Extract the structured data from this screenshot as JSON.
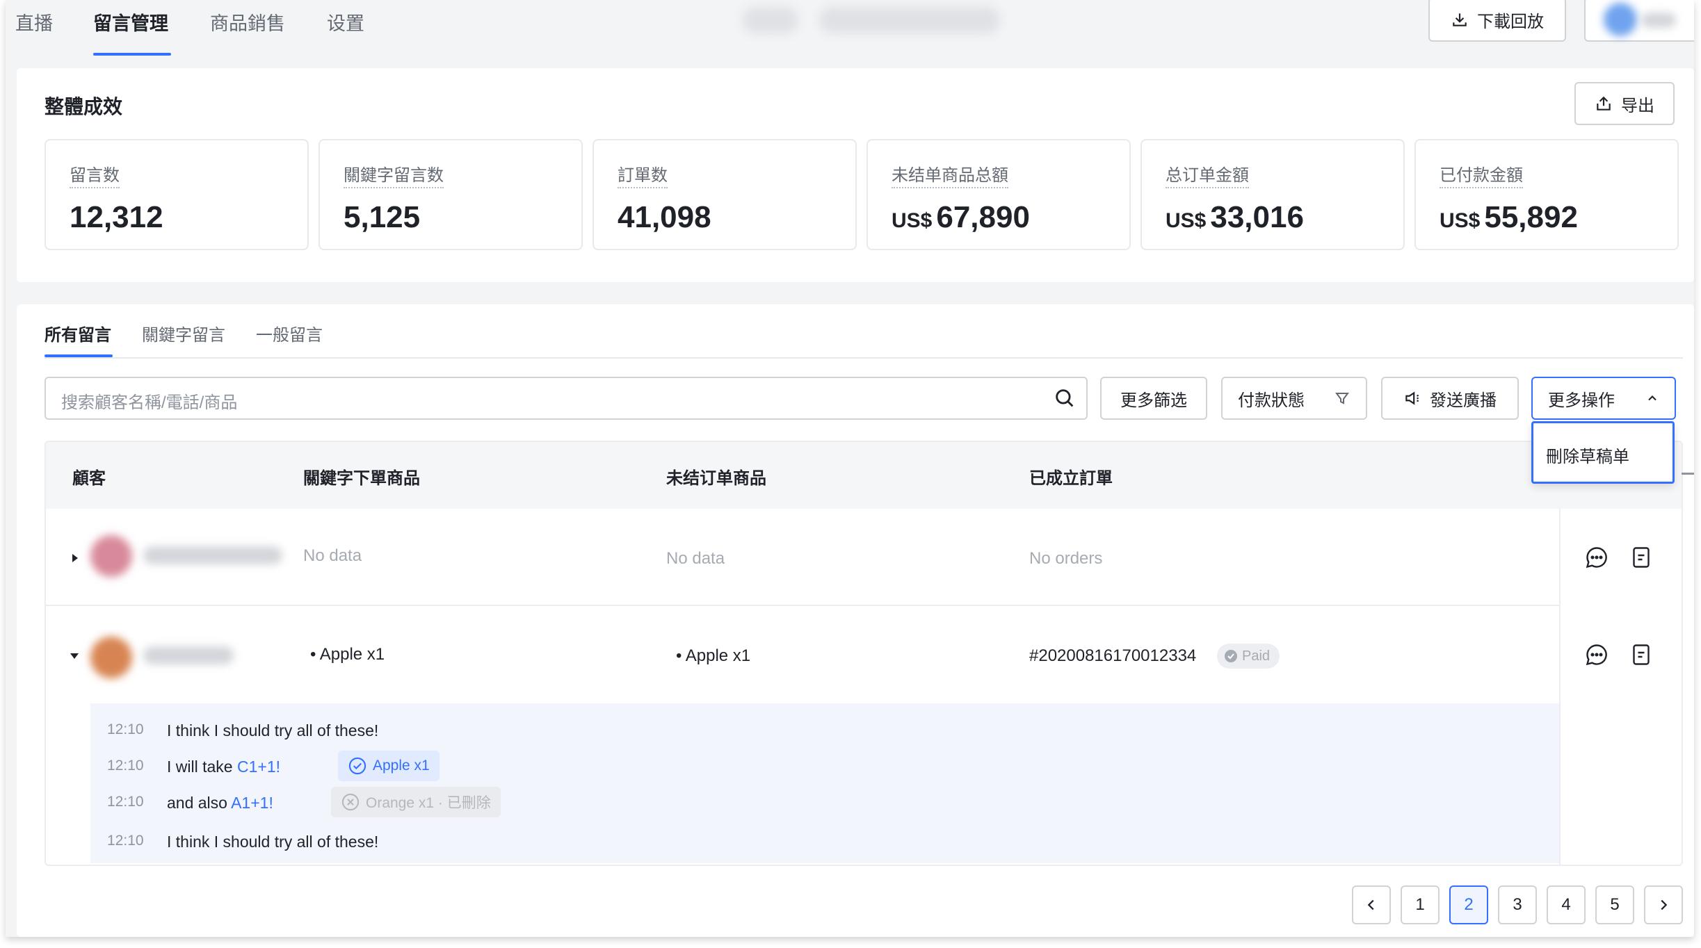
{
  "nav": {
    "tabs": [
      "直播",
      "留言管理",
      "商品銷售",
      "设置"
    ],
    "download_label": "下載回放"
  },
  "summary": {
    "title": "整體成效",
    "export_label": "导出",
    "stats": [
      {
        "label": "留言数",
        "currency": "",
        "value": "12,312"
      },
      {
        "label": "關鍵字留言数",
        "currency": "",
        "value": "5,125"
      },
      {
        "label": "訂單数",
        "currency": "",
        "value": "41,098"
      },
      {
        "label": "未结单商品总額",
        "currency": "US$",
        "value": "67,890"
      },
      {
        "label": "总订单金額",
        "currency": "US$",
        "value": "33,016"
      },
      {
        "label": "已付款金額",
        "currency": "US$",
        "value": "55,892"
      }
    ]
  },
  "comments": {
    "tabs": [
      "所有留言",
      "關鍵字留言",
      "一般留言"
    ],
    "search_placeholder": "搜索顧客名稱/電話/商品",
    "filters": {
      "more_filter": "更多篩选",
      "payment_status": "付款狀態",
      "broadcast": "發送廣播",
      "more_actions": "更多操作"
    },
    "dropdown_items": [
      "刪除草稿单"
    ],
    "columns": [
      "顧客",
      "關鍵字下單商品",
      "未结订单商品",
      "已成立訂單"
    ],
    "rows": [
      {
        "keyword_items": "No data",
        "pending_items": "No data",
        "orders": "No orders"
      },
      {
        "keyword_items": "• Apple x1",
        "pending_items": "• Apple x1",
        "orders": "#20200816170012334",
        "order_status": "Paid"
      }
    ],
    "chat": [
      {
        "time": "12:10",
        "text": "I think I should try all of these!"
      },
      {
        "time": "12:10",
        "text": "I will take ",
        "keyword": "C1+1!",
        "tag": "Apple x1"
      },
      {
        "time": "12:10",
        "text": "and also ",
        "keyword": "A1+1!",
        "tag": "Orange x1 · 已刪除"
      },
      {
        "time": "12:10",
        "text": "I think I should try all of these!"
      }
    ]
  },
  "pagination": {
    "pages": [
      "1",
      "2",
      "3",
      "4",
      "5"
    ],
    "current": "2"
  },
  "colors": {
    "accent": "#3370ff",
    "text": "#1f2329",
    "muted": "#646a73",
    "background": "#f3f4f6"
  }
}
